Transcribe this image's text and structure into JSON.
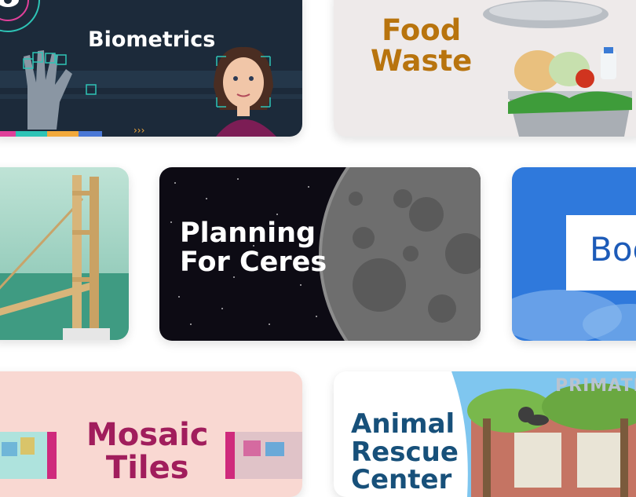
{
  "cards": [
    {
      "label": "Biometrics"
    },
    {
      "label": "Food\nWaste"
    },
    {
      "label": ""
    },
    {
      "label": "Planning\nFor Ceres"
    },
    {
      "label": "Boo"
    },
    {
      "label": "Mosaic\nTiles"
    },
    {
      "label": "Animal\nRescue\nCenter"
    }
  ],
  "banner_text": "PRIMATE",
  "colors": {
    "biometrics_bg": "#1c2a3a",
    "food_title": "#b8740e",
    "mosaic_title": "#a11d5c",
    "animal_title": "#17507a",
    "boo_bg": "#2f79dc",
    "boo_text": "#1d5bb8"
  }
}
